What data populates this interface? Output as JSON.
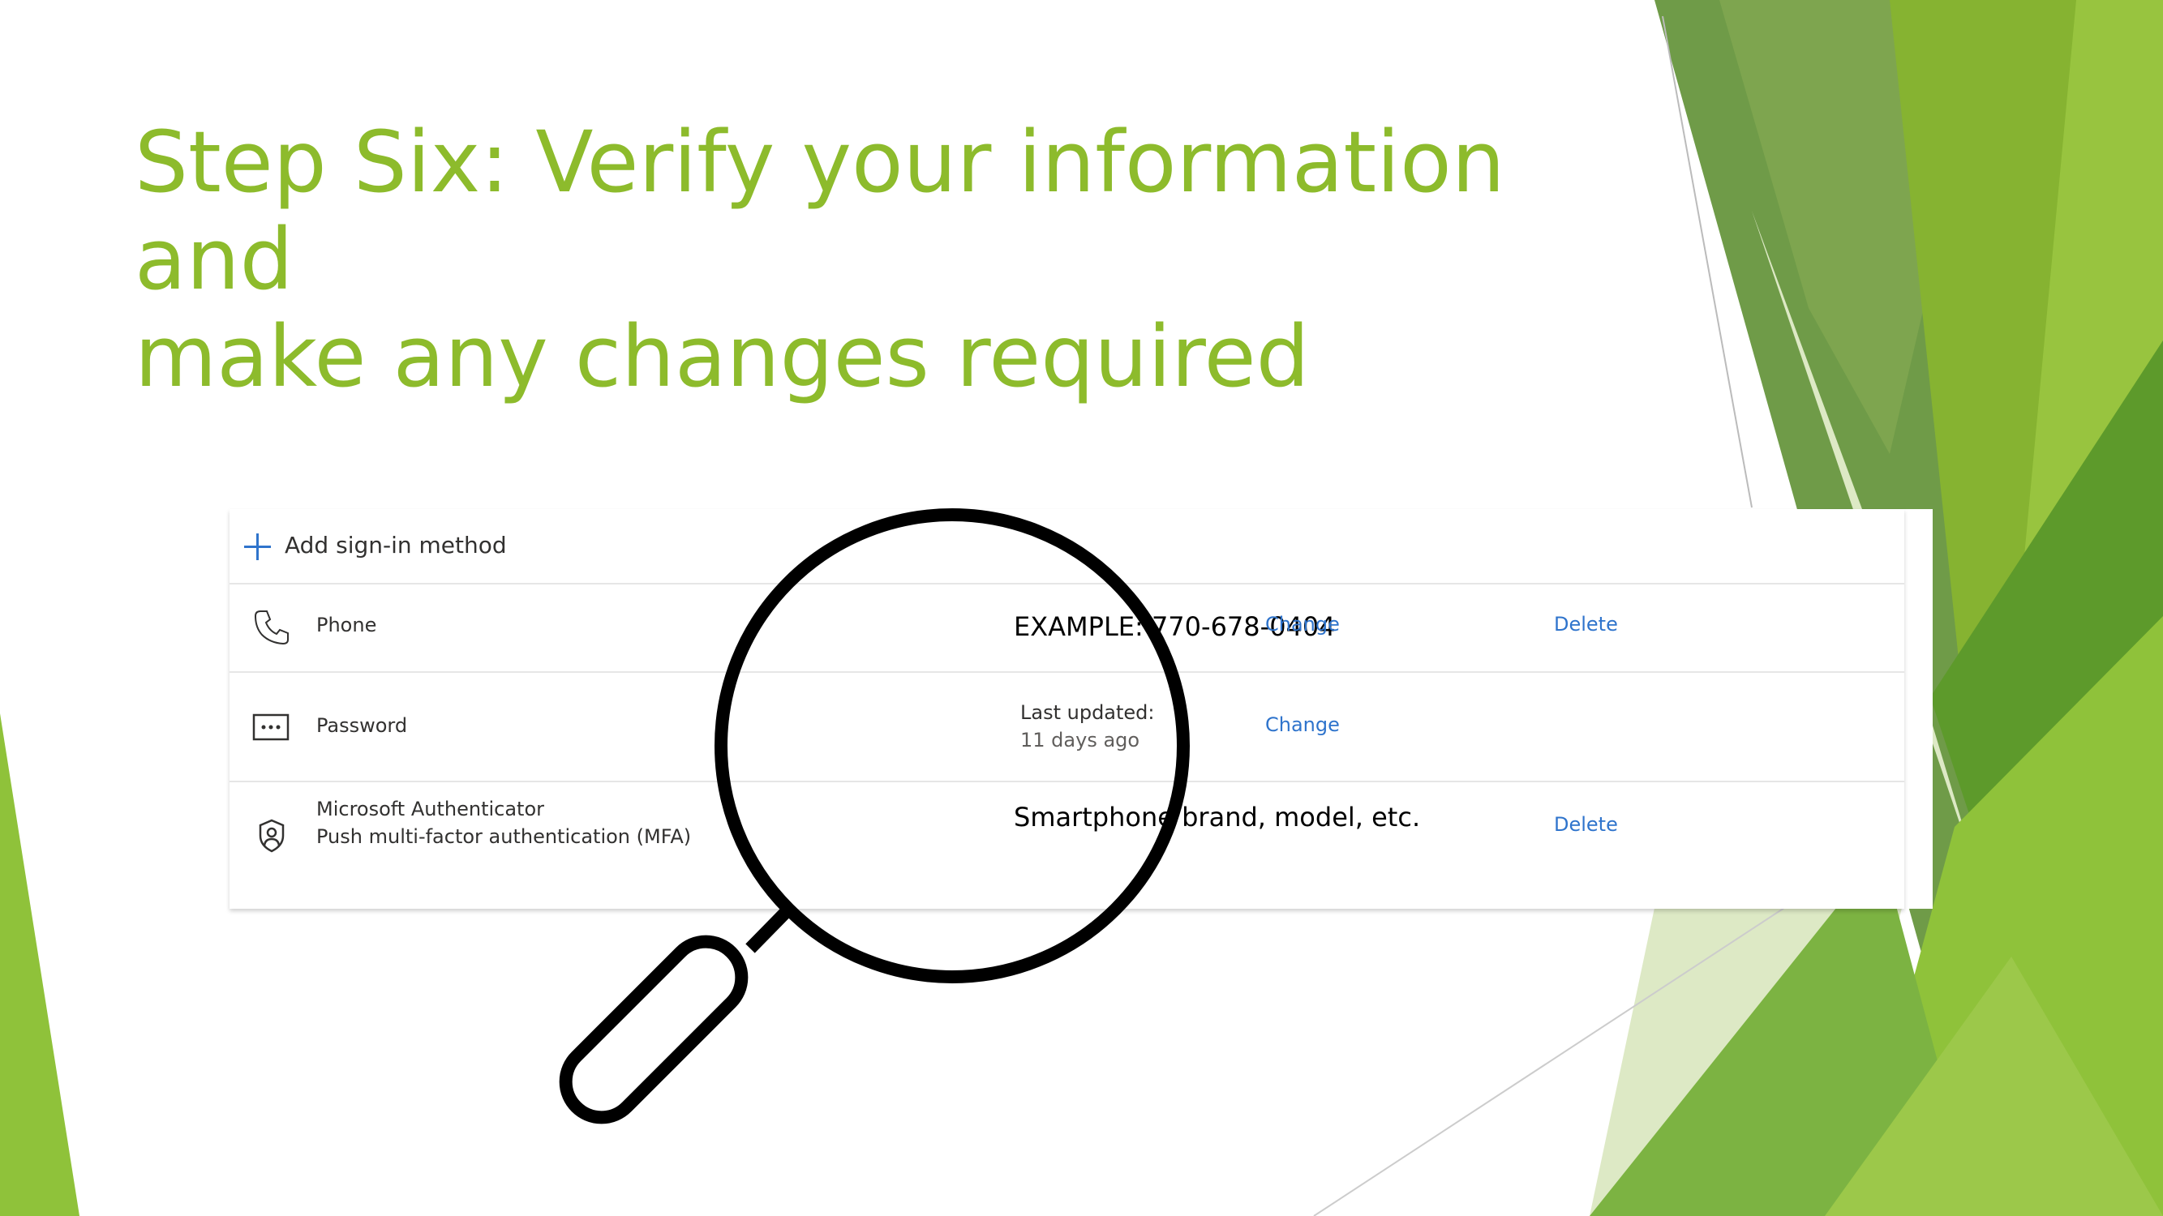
{
  "slide": {
    "title_line1": "Step Six: Verify your information and",
    "title_line2": "make any changes required",
    "accent_color": "#8dbb2c"
  },
  "panel": {
    "add_method_label": "Add sign-in method",
    "add_icon": "plus-icon",
    "methods": [
      {
        "icon": "phone-icon",
        "name": "Phone",
        "detail": "EXAMPLE: 770-678-0404",
        "change_label": "Change",
        "delete_label": "Delete"
      },
      {
        "icon": "password-icon",
        "name": "Password",
        "detail_label": "Last updated:",
        "detail_value": "11 days ago",
        "change_label": "Change"
      },
      {
        "icon": "authenticator-icon",
        "name": "Microsoft Authenticator",
        "subname": "Push multi-factor authentication (MFA)",
        "detail": "Smartphone brand, model, etc.",
        "delete_label": "Delete"
      }
    ],
    "link_color": "#2f74cc"
  },
  "overlay": {
    "icon": "magnifying-glass-icon"
  }
}
